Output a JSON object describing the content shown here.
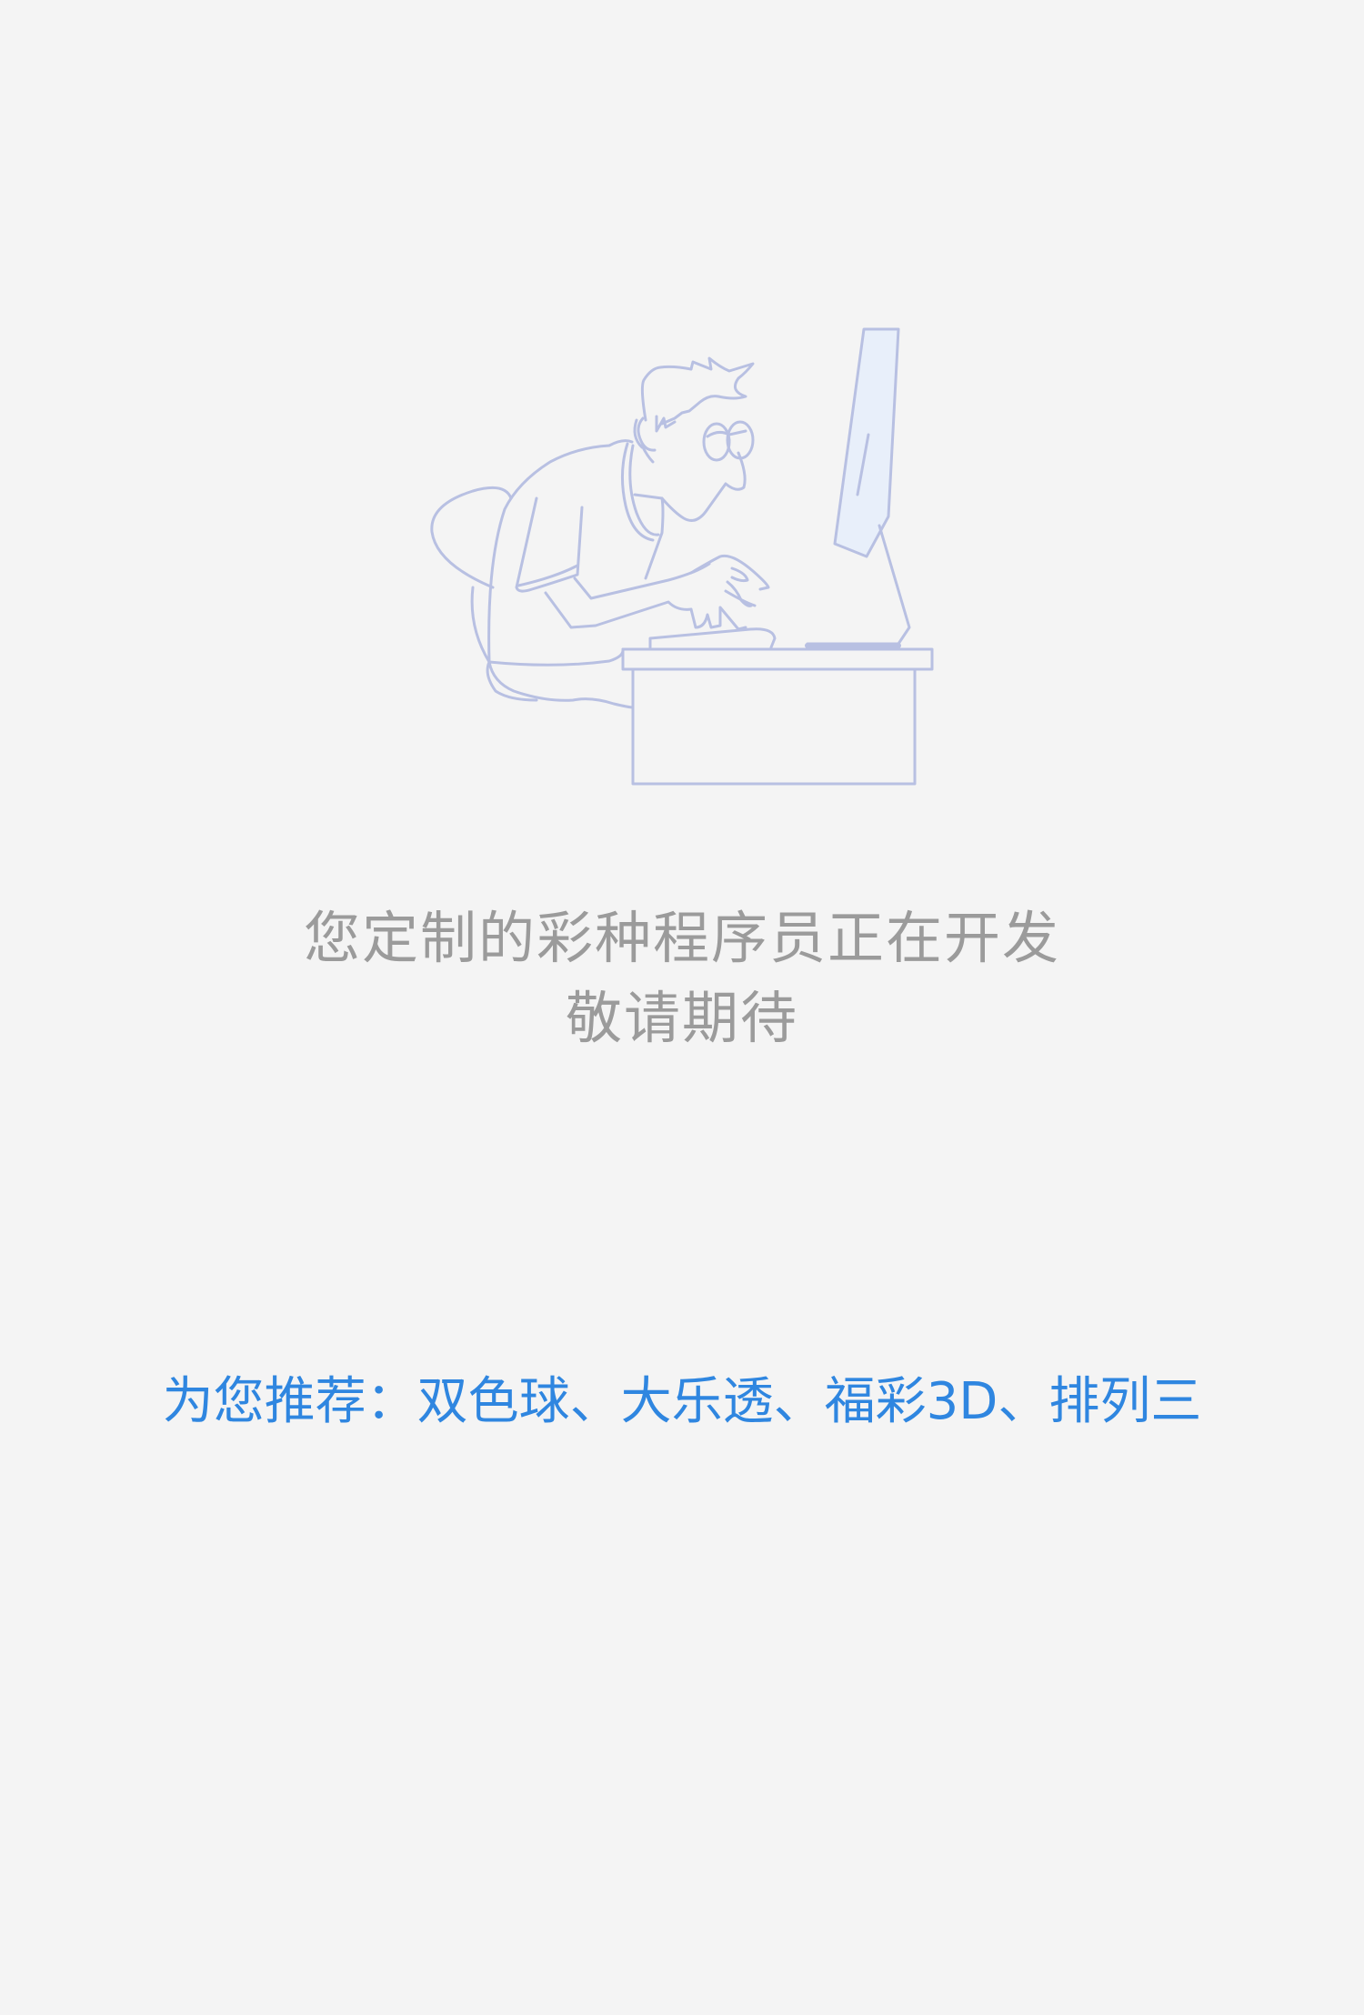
{
  "status": {
    "line1": "您定制的彩种程序员正在开发",
    "line2": "敬请期待"
  },
  "illustration": {
    "icon": "programmer-at-computer-illustration",
    "stroke_color": "#b8c0e2",
    "screen_fill": "#e8effa"
  },
  "recommend": {
    "prefix": "为您推荐：",
    "separator": "、",
    "items": [
      {
        "label": "双色球"
      },
      {
        "label": "大乐透"
      },
      {
        "label": "福彩3D"
      },
      {
        "label": "排列三"
      }
    ],
    "color": "#2f86e0"
  }
}
